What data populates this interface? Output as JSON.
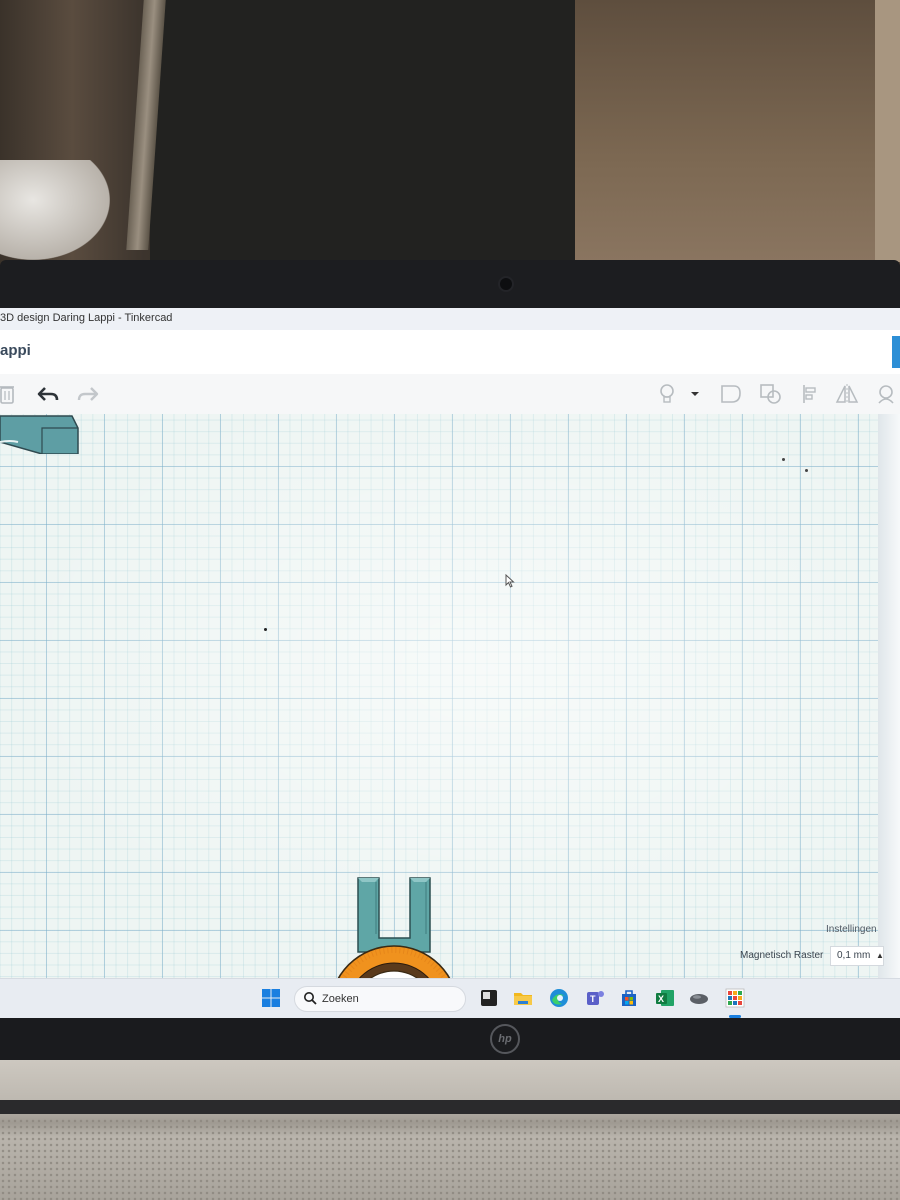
{
  "window": {
    "title": "3D design Daring Lappi - Tinkercad"
  },
  "app": {
    "design_name": "appi"
  },
  "toolbar": {
    "tools": [
      "trash-icon",
      "undo-icon",
      "redo-icon",
      "light-bulb-icon",
      "dropdown-icon",
      "group-icon",
      "ungroup-icon",
      "align-icon",
      "mirror-icon",
      "cruise-icon"
    ]
  },
  "workplane": {
    "settings_label": "Instellingen",
    "snap_grid_label": "Magnetisch Raster",
    "snap_grid_value": "0,1 mm",
    "colors": {
      "ring": "#f0921e",
      "clip": "#5fa6a6",
      "grid": "#78aac8"
    }
  },
  "taskbar": {
    "search_placeholder": "Zoeken",
    "apps": [
      "windows-start-icon",
      "task-view-icon",
      "file-explorer-icon",
      "edge-icon",
      "teams-icon",
      "store-icon",
      "excel-icon",
      "mouse-app-icon",
      "tinkercad-app-icon"
    ]
  },
  "device": {
    "brand": "hp"
  }
}
